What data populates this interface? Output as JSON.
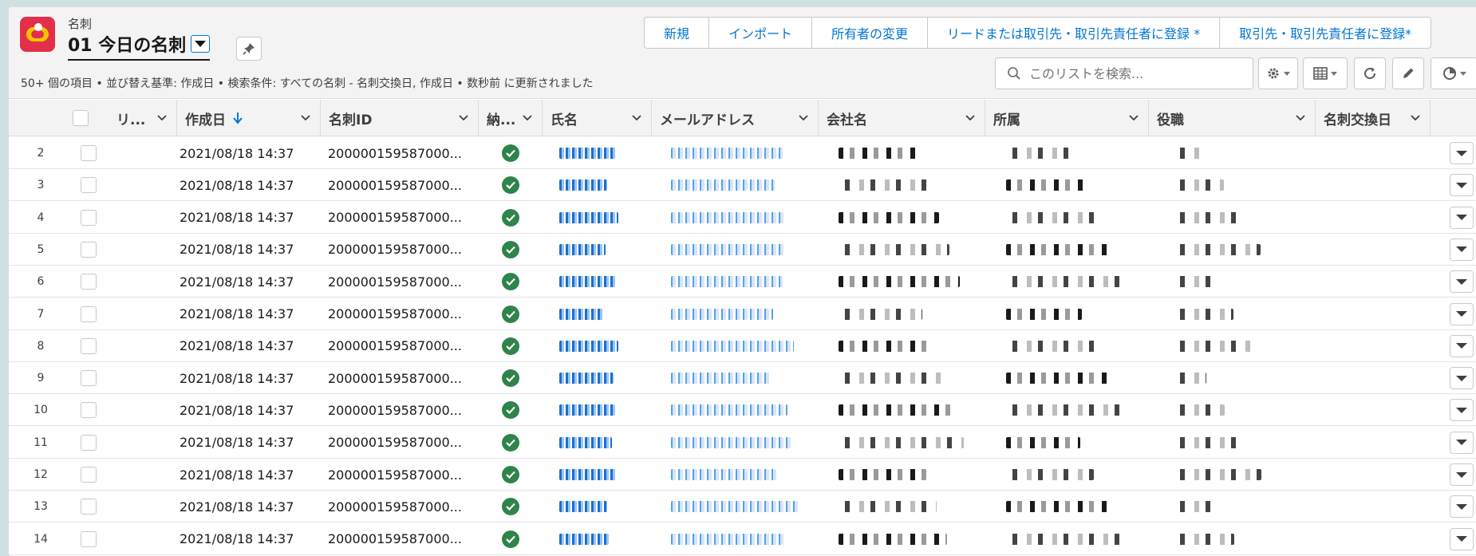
{
  "header": {
    "object_label": "名刺",
    "list_title": "01 今日の名刺",
    "subtitle": "50+ 個の項目 • 並び替え基準: 作成日 • 検索条件: すべての名刺 - 名刺交換日, 作成日 • 数秒前 に更新されました",
    "buttons": [
      "新規",
      "インポート",
      "所有者の変更",
      "リードまたは取引先・取引先責任者に登録 *",
      "取引先・取引先責任者に登録*"
    ],
    "search_placeholder": "このリストを検索..."
  },
  "table": {
    "columns": [
      "リ...",
      "作成日",
      "名刺ID",
      "納...",
      "氏名",
      "メールアドレス",
      "会社名",
      "所属",
      "役職",
      "名刺交換日"
    ],
    "sort_column": "作成日",
    "rows": [
      {
        "num": "2",
        "created": "2021/08/18 14:37",
        "card_id": "200000159587000..."
      },
      {
        "num": "3",
        "created": "2021/08/18 14:37",
        "card_id": "200000159587000..."
      },
      {
        "num": "4",
        "created": "2021/08/18 14:37",
        "card_id": "200000159587000..."
      },
      {
        "num": "5",
        "created": "2021/08/18 14:37",
        "card_id": "200000159587000..."
      },
      {
        "num": "6",
        "created": "2021/08/18 14:37",
        "card_id": "200000159587000..."
      },
      {
        "num": "7",
        "created": "2021/08/18 14:37",
        "card_id": "200000159587000..."
      },
      {
        "num": "8",
        "created": "2021/08/18 14:37",
        "card_id": "200000159587000..."
      },
      {
        "num": "9",
        "created": "2021/08/18 14:37",
        "card_id": "200000159587000..."
      },
      {
        "num": "10",
        "created": "2021/08/18 14:37",
        "card_id": "200000159587000..."
      },
      {
        "num": "11",
        "created": "2021/08/18 14:37",
        "card_id": "200000159587000..."
      },
      {
        "num": "12",
        "created": "2021/08/18 14:37",
        "card_id": "200000159587000..."
      },
      {
        "num": "13",
        "created": "2021/08/18 14:37",
        "card_id": "200000159587000..."
      },
      {
        "num": "14",
        "created": "2021/08/18 14:37",
        "card_id": "200000159587000..."
      }
    ]
  },
  "icons": {
    "app": "business-card-app-icon",
    "pin": "pin-icon",
    "search": "search-icon",
    "settings": "gear-icon",
    "view": "table-view-icon",
    "refresh": "refresh-icon",
    "edit": "pencil-icon",
    "chart": "pie-chart-icon",
    "status": "check-circle-icon",
    "row_menu": "chevron-down-icon"
  },
  "colors": {
    "brand_blue": "#0176d3",
    "success_green": "#2e844a",
    "app_icon_red": "#e2304a"
  }
}
